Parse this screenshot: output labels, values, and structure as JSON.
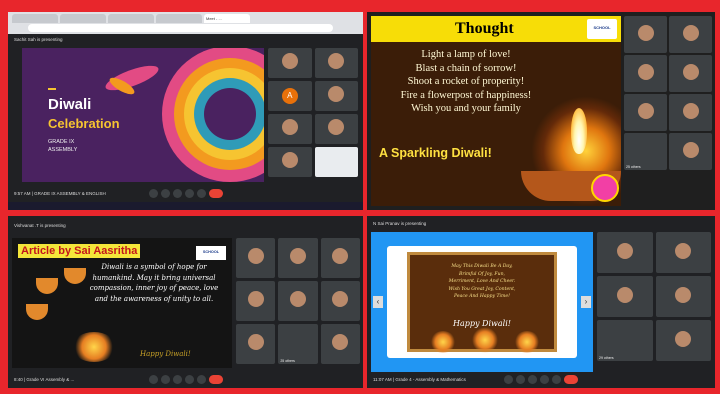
{
  "panel1": {
    "tabs": [
      "Meet - ..."
    ],
    "meet_header": "Sachit Sah is presenting",
    "slide": {
      "title_line1": "Diwali",
      "title_line2": "Celebration",
      "subtitle": "GRADE IX\nASSEMBLY"
    },
    "tiles": [
      "",
      "",
      "",
      "",
      "",
      "",
      "",
      ""
    ],
    "avatar_letter": "A",
    "footer_meeting": "9:57 AM  |  GRADE IX ASSEMBLY & ENGLISH"
  },
  "panel2": {
    "header": "Thought",
    "logo_text": "SCHOOL",
    "poem": [
      "Light a lamp of love!",
      "Blast a chain of sorrow!",
      "Shoot a rocket of properity!",
      "Fire a flowerpost of happiness!",
      "Wish you and your family"
    ],
    "tagline": "A Sparkling Diwali!",
    "side_count_label": "25 others"
  },
  "panel3": {
    "meet_header": "Vishvanat .T is presenting",
    "slide": {
      "tag": "Article by Sai Aasritha",
      "logo_text": "SCHOOL",
      "body": "Diwali is a symbol of hope for humankind. May it bring universal compassion, inner joy of peace, love and the awareness of unity to all.",
      "happy": "Happy Diwali!"
    },
    "footer_meeting": "8:40 |  Grade VI Assembly & ...",
    "others_label": "25 others"
  },
  "panel4": {
    "meet_header": "N Sai Pranav is presenting",
    "slide": {
      "wishes": "May This Diwali Be A Day,\nBrimful Of Joy, Fun,\nMerriment, Love And Cheer.\nWish You Great Joy, Content,\nPeace And Happy Time!",
      "happy": "Happy Diwali!"
    },
    "footer_meeting": "11:07 AM  |  Grade 4 - Assembly & Mathematics",
    "others_label": "29 others"
  },
  "colors": {
    "frame": "#e8262c",
    "meet_bg": "#202124",
    "end_call": "#ea4335"
  }
}
